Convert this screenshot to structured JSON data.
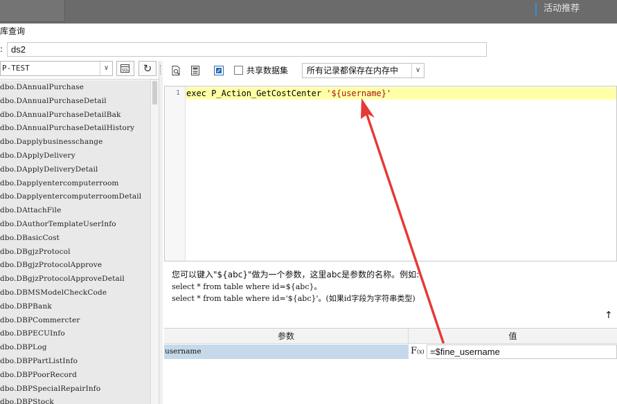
{
  "topbar": {
    "activity_label": "活动推荐"
  },
  "dialog": {
    "title": "库查询",
    "name_label": ":",
    "name_value": "ds2"
  },
  "left_panel": {
    "connection": "P-TEST",
    "tables": [
      "dbo.DAnnualPurchase",
      "dbo.DAnnualPurchaseDetail",
      "dbo.DAnnualPurchaseDetailBak",
      "dbo.DAnnualPurchaseDetailHistory",
      "dbo.Dapplybusinesschange",
      "dbo.DApplyDelivery",
      "dbo.DApplyDeliveryDetail",
      "dbo.Dapplyentercomputerroom",
      "dbo.DapplyentercomputerroomDetail",
      "dbo.DAttachFile",
      "dbo.DAuthorTemplateUserInfo",
      "dbo.DBasicCost",
      "dbo.DBgjzProtocol",
      "dbo.DBgjzProtocolApprove",
      "dbo.DBgjzProtocolApproveDetail",
      "dbo.DBMSModelCheckCode",
      "dbo.DBPBank",
      "dbo.DBPCommercter",
      "dbo.DBPECUInfo",
      "dbo.DBPLog",
      "dbo.DBPPartListInfo",
      "dbo.DBPPoorRecord",
      "dbo.DBPSpecialRepairInfo",
      "dbo.DBPStock"
    ]
  },
  "toolbar": {
    "share_label": "共享数据集",
    "memory_option": "所有记录都保存在内存中"
  },
  "editor": {
    "line_number": "1",
    "code_prefix": "exec P_Action_GetCostCenter ",
    "code_string": "'${username}'"
  },
  "hint": {
    "line1": "您可以键入\"${abc}\"做为一个参数，这里abc是参数的名称。例如:",
    "line2": "select * from table where id=${abc}。",
    "line3": "select * from table where id='${abc}'。(如果id字段为字符串类型)"
  },
  "params": {
    "header_param": "参数",
    "header_value": "值",
    "rows": [
      {
        "name": "username",
        "value": "=$fine_username"
      }
    ]
  },
  "icons": {
    "fx": "F(x)",
    "scroll_up": "↑"
  },
  "colors": {
    "annotation_arrow": "#e53935",
    "editor_highlight": "#ffffa8",
    "selected_row": "#c5d9ea"
  }
}
